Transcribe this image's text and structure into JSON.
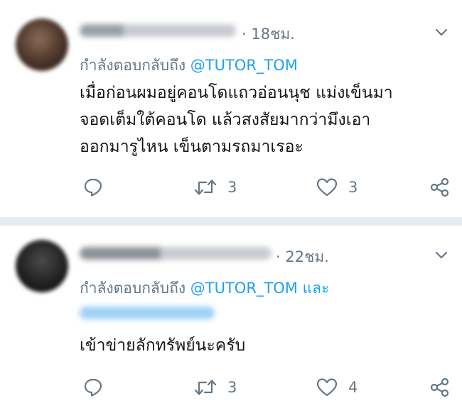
{
  "tweets": [
    {
      "time": "· 18ชม.",
      "reply_prefix": "กำลังตอบกลับถึง",
      "reply_mention": "@TUTOR_TOM",
      "reply_suffix": "",
      "text": "เมื่อก่อนผมอยู่คอนโดแถวอ่อนนุช แม่งเข็นมา\nจอดเต็มใต้คอนโด แล้วสงสัยมากว่ามึงเอา\nออกมารูไหน เข็นตามรถมาเรอะ",
      "retweets": "3",
      "likes": "3"
    },
    {
      "time": "· 22ชม.",
      "reply_prefix": "กำลังตอบกลับถึง",
      "reply_mention": "@TUTOR_TOM",
      "reply_suffix": "และ",
      "text": "เข้าข่ายลักทรัพย์นะครับ",
      "retweets": "3",
      "likes": "4"
    }
  ],
  "icons": {
    "menu": "chevron-down-icon",
    "reply": "reply-icon",
    "retweet": "retweet-icon",
    "like": "heart-icon",
    "share": "share-icon"
  },
  "colors": {
    "link": "#1da1f2",
    "secondary_text": "#657786",
    "primary_text": "#14171a",
    "divider": "#e6ecf0"
  }
}
